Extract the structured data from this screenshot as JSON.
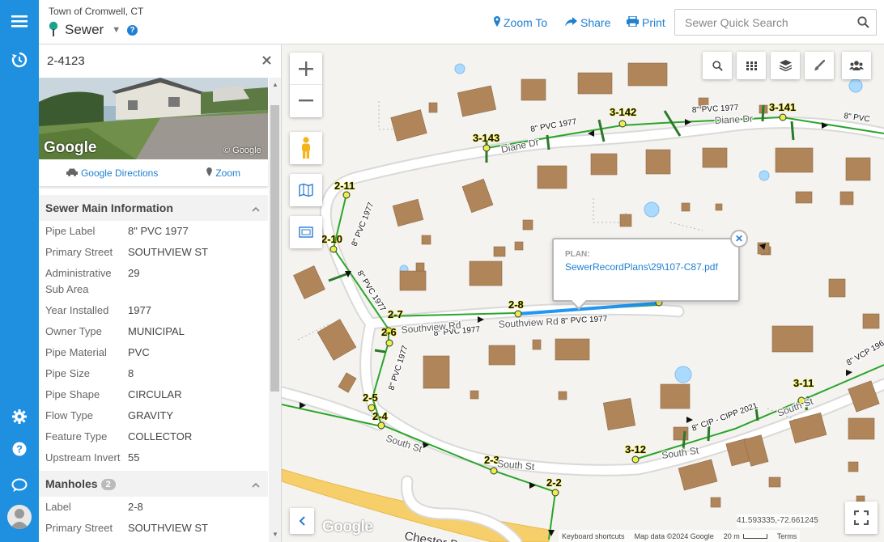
{
  "header": {
    "town": "Town of Cromwell, CT",
    "layer": "Sewer",
    "zoom_to": "Zoom To",
    "share": "Share",
    "print": "Print",
    "search_placeholder": "Sewer Quick Search"
  },
  "panel": {
    "title": "2-4123",
    "photo_watermark": "Google",
    "photo_copyright": "© Google",
    "directions_label": "Google Directions",
    "zoom_label": "Zoom",
    "sewer_main": {
      "heading": "Sewer Main Information",
      "rows": [
        {
          "k": "Pipe Label",
          "v": "8\" PVC 1977"
        },
        {
          "k": "Primary Street",
          "v": "SOUTHVIEW ST"
        },
        {
          "k": "Administrative Sub Area",
          "v": "29"
        },
        {
          "k": "Year Installed",
          "v": "1977"
        },
        {
          "k": "Owner Type",
          "v": "MUNICIPAL"
        },
        {
          "k": "Pipe Material",
          "v": "PVC"
        },
        {
          "k": "Pipe Size",
          "v": "8"
        },
        {
          "k": "Pipe Shape",
          "v": "CIRCULAR"
        },
        {
          "k": "Flow Type",
          "v": "GRAVITY"
        },
        {
          "k": "Feature Type",
          "v": "COLLECTOR"
        },
        {
          "k": "Upstream Invert",
          "v": "55"
        }
      ]
    },
    "manholes": {
      "heading": "Manholes",
      "count": "2",
      "rows": [
        {
          "k": "Label",
          "v": "2-8"
        },
        {
          "k": "Primary Street",
          "v": "SOUTHVIEW ST"
        }
      ]
    }
  },
  "map": {
    "popup_label": "PLAN:",
    "popup_value": "SewerRecordPlans\\29\\107-C87.pdf",
    "coords": "41.593335,-72.661245",
    "keyboard": "Keyboard shortcuts",
    "map_data": "Map data ©2024 Google",
    "scale": "20 m",
    "terms": "Terms",
    "google_logo": "Google",
    "streets": {
      "diane": "Diane Dr",
      "diane2": "Diane Dr",
      "southview": "Southview Rd",
      "southview2": "Southview Rd",
      "south_st1": "South St",
      "south_st2": "South St",
      "south_st3": "South St",
      "south_st4": "South St",
      "chester": "Chester Bowles Hwy"
    },
    "manhole_labels": [
      "3-143",
      "3-142",
      "3-141",
      "2-11",
      "2-10",
      "2-7",
      "2-6",
      "2-8",
      "2-5",
      "2-4",
      "2-3",
      "2-2",
      "3-12",
      "3-11"
    ],
    "pipe_labels": {
      "p1": "8\" PVC 1977",
      "p2": "8\" PVC 1977",
      "p3": "8\" PVC",
      "p4": "8\" PVC 1977",
      "p5": "8\" PVC 1977",
      "p6": "8\" PVC 1977",
      "p7": "8\" PVC 1977",
      "p8": "8\" PVC 1977",
      "p9": "8\" CIP - CIPP 2021",
      "p10": "8\" VCP 196"
    },
    "colors": {
      "pipe": "#2aa52a",
      "selected_pipe": "#2196f3",
      "building": "#b0855a",
      "road": "#ffffff",
      "highway": "#f6cf6a"
    }
  },
  "icons": [
    "menu-icon",
    "history-icon",
    "gear-icon",
    "question-icon",
    "chat-icon",
    "user-icon",
    "pin-icon",
    "share-icon",
    "print-icon",
    "search-icon",
    "layers-icon",
    "grid-icon",
    "brush-icon",
    "group-icon",
    "pegman-icon",
    "map-icon",
    "frame-icon",
    "fullscreen-icon",
    "car-icon"
  ]
}
